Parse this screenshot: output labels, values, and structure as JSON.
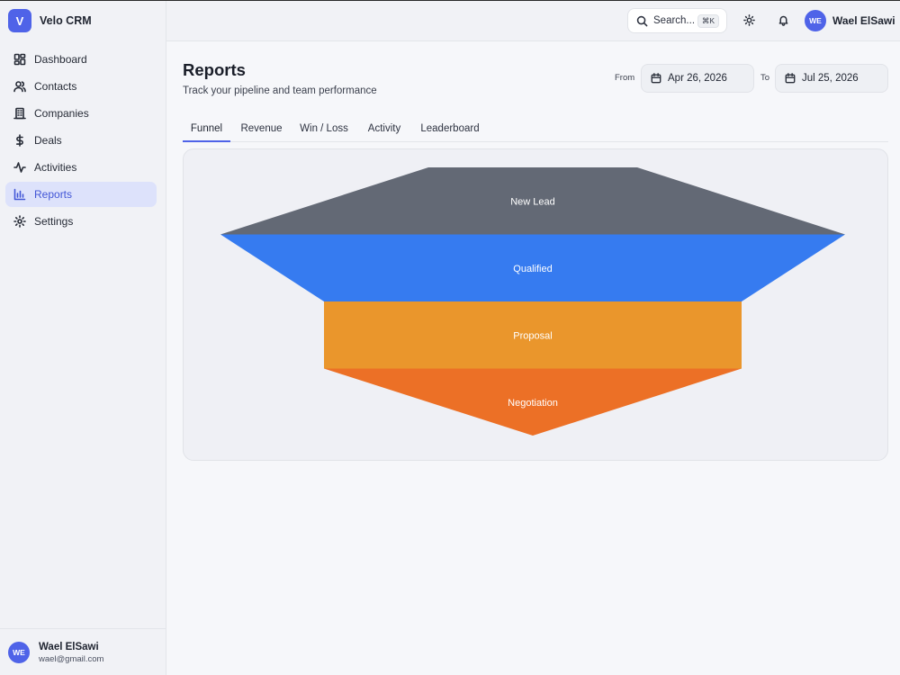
{
  "app": {
    "logo_letter": "V",
    "name": "Velo CRM"
  },
  "sidebar": {
    "items": [
      {
        "label": "Dashboard",
        "icon": "dashboard-icon",
        "active": false
      },
      {
        "label": "Contacts",
        "icon": "users-icon",
        "active": false
      },
      {
        "label": "Companies",
        "icon": "building-icon",
        "active": false
      },
      {
        "label": "Deals",
        "icon": "dollar-icon",
        "active": false
      },
      {
        "label": "Activities",
        "icon": "activity-icon",
        "active": false
      },
      {
        "label": "Reports",
        "icon": "bar-chart-icon",
        "active": true
      },
      {
        "label": "Settings",
        "icon": "gear-icon",
        "active": false
      }
    ],
    "user": {
      "initials": "WE",
      "name": "Wael ElSawi",
      "email": "wael@gmail.com"
    }
  },
  "topbar": {
    "search_label": "Search...",
    "search_shortcut": "⌘K",
    "user": {
      "initials": "WE",
      "name": "Wael ElSawi"
    }
  },
  "page": {
    "title": "Reports",
    "subtitle": "Track your pipeline and team performance",
    "from_label": "From",
    "from_date": "Apr 26, 2026",
    "to_label": "To",
    "to_date": "Jul 25, 2026"
  },
  "tabs": [
    {
      "label": "Funnel",
      "active": true
    },
    {
      "label": "Revenue",
      "active": false
    },
    {
      "label": "Win / Loss",
      "active": false
    },
    {
      "label": "Activity",
      "active": false
    },
    {
      "label": "Leaderboard",
      "active": false
    }
  ],
  "colors": {
    "accent": "#4f63e8"
  },
  "chart_data": {
    "type": "funnel",
    "stages": [
      {
        "label": "New Lead",
        "color": "#636975"
      },
      {
        "label": "Qualified",
        "color": "#367bf0"
      },
      {
        "label": "Proposal",
        "color": "#ea962c"
      },
      {
        "label": "Negotiation",
        "color": "#ec7026"
      }
    ]
  }
}
